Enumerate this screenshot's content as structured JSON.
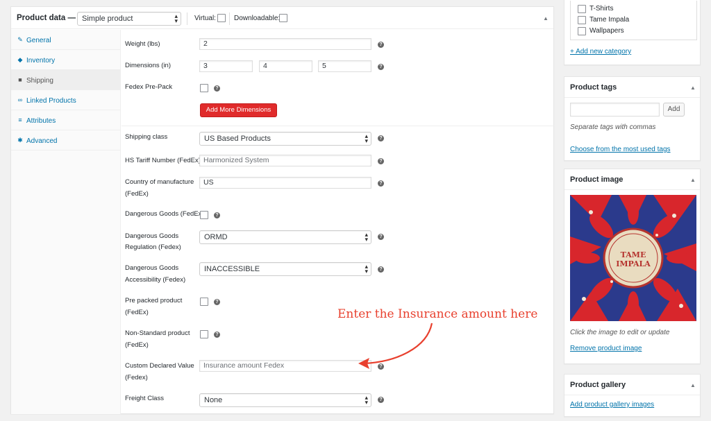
{
  "product_data": {
    "title": "Product data —",
    "type_select": "Simple product",
    "virtual_label": "Virtual:",
    "downloadable_label": "Downloadable:",
    "collapse": "▲"
  },
  "tabs": [
    {
      "label": "General",
      "icon": "wrench-icon",
      "glyph": "✎"
    },
    {
      "label": "Inventory",
      "icon": "tag-icon",
      "glyph": "◆"
    },
    {
      "label": "Shipping",
      "icon": "truck-icon",
      "glyph": "■"
    },
    {
      "label": "Linked Products",
      "icon": "link-icon",
      "glyph": "∞"
    },
    {
      "label": "Attributes",
      "icon": "list-icon",
      "glyph": "≡"
    },
    {
      "label": "Advanced",
      "icon": "gear-icon",
      "glyph": "✱"
    }
  ],
  "shipping": {
    "weight_label": "Weight (lbs)",
    "weight_value": "2",
    "dimensions_label": "Dimensions (in)",
    "dim_length": "3",
    "dim_width": "4",
    "dim_height": "5",
    "fedex_prepack_label": "Fedex Pre-Pack",
    "add_dimensions_button": "Add More Dimensions",
    "shipping_class_label": "Shipping class",
    "shipping_class_value": "US Based Products",
    "hs_tariff_label": "HS Tariff Number (FedEx)",
    "hs_tariff_placeholder": "Harmonized System",
    "country_label_1": "Country of manufacture",
    "country_label_2": "(FedEx)",
    "country_value": "US",
    "dangerous_goods_label": "Dangerous Goods (FedEx)",
    "dg_regulation_label_1": "Dangerous Goods",
    "dg_regulation_label_2": "Regulation (Fedex)",
    "dg_regulation_value": "ORMD",
    "dg_accessibility_label_1": "Dangerous Goods",
    "dg_accessibility_label_2": "Accessibility (Fedex)",
    "dg_accessibility_value": "INACCESSIBLE",
    "prepacked_label_1": "Pre packed product",
    "prepacked_label_2": "(FedEx)",
    "nonstandard_label_1": "Non-Standard product",
    "nonstandard_label_2": "(FedEx)",
    "custom_value_label_1": "Custom Declared Value",
    "custom_value_label_2": "(Fedex)",
    "custom_value_placeholder": "Insurance amount Fedex",
    "freight_class_label": "Freight Class",
    "freight_class_value": "None",
    "help_glyph": "?"
  },
  "annotation": {
    "text": "Enter the Insurance amount here",
    "color": "#e8402e"
  },
  "categories": {
    "items": [
      "T-Shirts",
      "Tame Impala",
      "Wallpapers"
    ],
    "add_link": "+ Add new category"
  },
  "product_tags": {
    "title": "Product tags",
    "add_button": "Add",
    "hint": "Separate tags with commas",
    "choose_link": "Choose from the most used tags"
  },
  "product_image": {
    "title": "Product image",
    "album_text_1": "TAME",
    "album_text_2": "IMPALA",
    "caption": "Click the image to edit or update",
    "remove_link": "Remove product image"
  },
  "product_gallery": {
    "title": "Product gallery",
    "add_link": "Add product gallery images"
  },
  "colors": {
    "link": "#0073aa",
    "button_red": "#e02b2b",
    "annotation": "#e8402e"
  }
}
